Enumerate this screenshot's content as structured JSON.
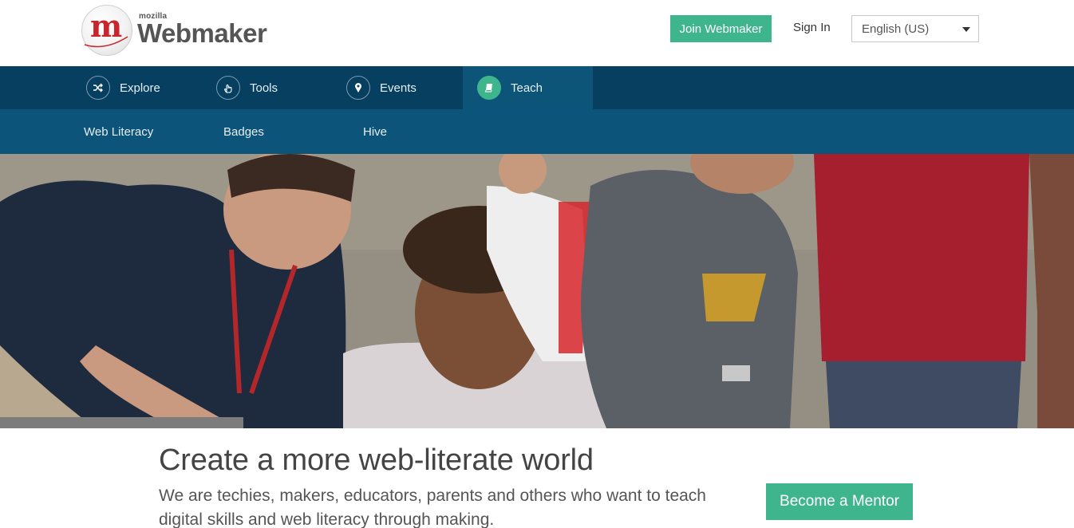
{
  "header": {
    "logo_mozilla": "mozilla",
    "logo_webmaker": "Webmaker",
    "join_label": "Join Webmaker",
    "signin_label": "Sign In",
    "language_selected": "English (US)"
  },
  "nav": {
    "items": [
      {
        "label": "Explore",
        "icon": "shuffle-icon"
      },
      {
        "label": "Tools",
        "icon": "pointer-hand-icon"
      },
      {
        "label": "Events",
        "icon": "map-pin-icon"
      },
      {
        "label": "Teach",
        "icon": "book-icon",
        "active": true
      }
    ]
  },
  "subnav": {
    "items": [
      "Web Literacy",
      "Badges",
      "Hive"
    ]
  },
  "hero": {
    "alt": "Photo of a young man and woman helping a child use a laptop outdoors"
  },
  "content": {
    "headline": "Create a more web-literate world",
    "blurb": "We are techies, makers, educators, parents and others who want to teach digital skills and web literacy through making.",
    "cta_label": "Become a Mentor"
  },
  "colors": {
    "accent": "#3fb58e",
    "nav_bg": "#073f60",
    "subnav_bg": "#0c5479",
    "brand_red": "#c9252c"
  }
}
